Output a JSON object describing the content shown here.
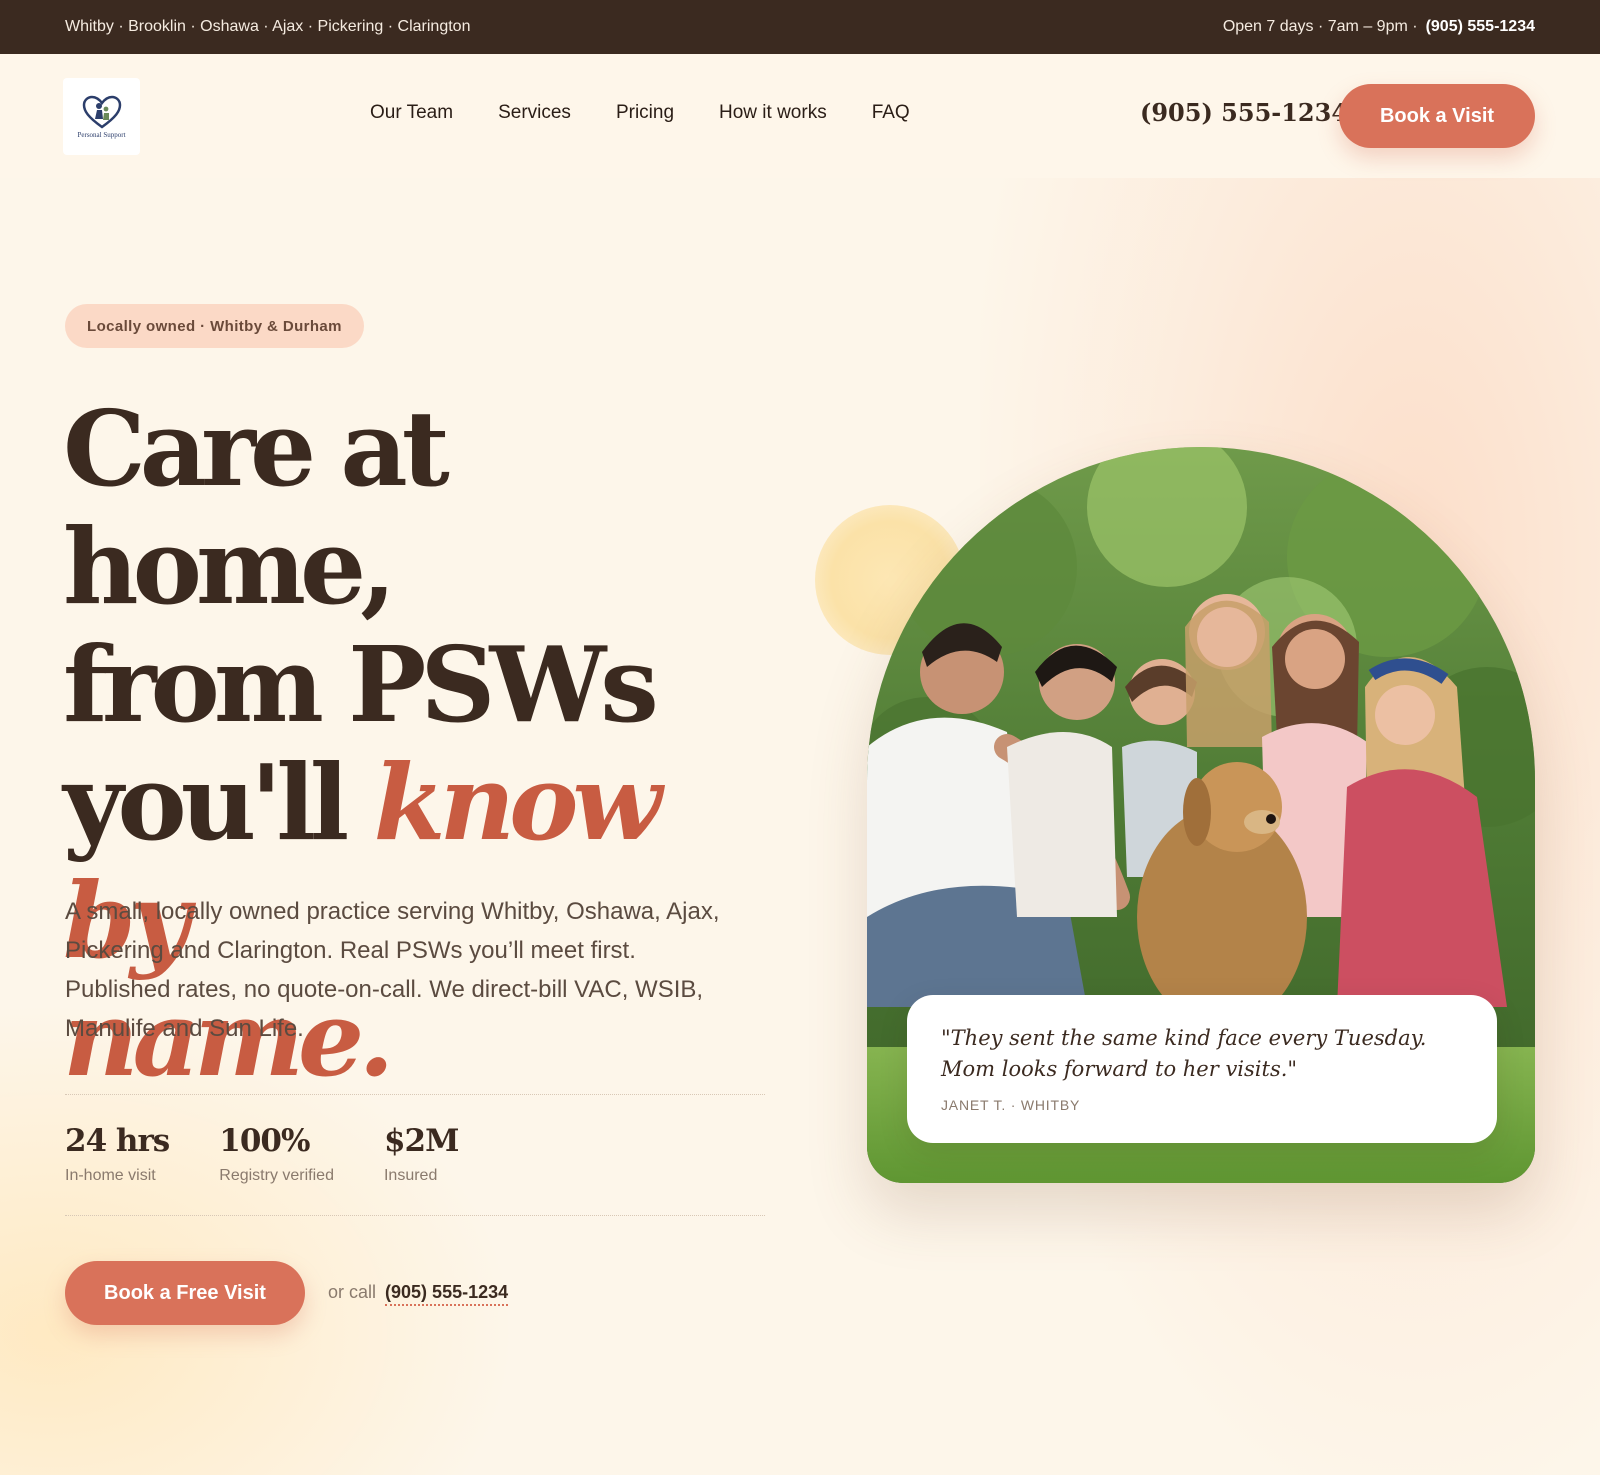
{
  "topbar": {
    "areas": "Whitby · Brooklin · Oshawa · Ajax · Pickering · Clarington",
    "hours": "Open 7 days · 7am – 9pm ·",
    "phone": "(905) 555-1234"
  },
  "header": {
    "logo_text": "Personal Support",
    "nav": [
      "Our Team",
      "Services",
      "Pricing",
      "How it works",
      "FAQ"
    ],
    "phone": "(905) 555-1234",
    "cta": "Book a Visit"
  },
  "hero": {
    "badge": "Locally owned · Whitby & Durham",
    "headline_line1": "Care at home,",
    "headline_line2": "from PSWs",
    "headline_line3_plain": "you'll ",
    "headline_line3_accent": "know by",
    "headline_line4_accent": "name.",
    "lede": "A small, locally owned practice serving Whitby, Oshawa, Ajax, Pickering and Clarington. Real PSWs you’ll meet first. Published rates, no quote-on-call. We direct-bill VAC, WSIB, Manulife and Sun Life.",
    "stats": [
      {
        "value": "24 hrs",
        "label": "In-home visit"
      },
      {
        "value": "100%",
        "label": "Registry verified"
      },
      {
        "value": "$2M",
        "label": "Insured"
      }
    ],
    "cta": "Book a Free Visit",
    "or_call": "or call",
    "cta_phone": "(905) 555-1234"
  },
  "testimonial": {
    "quote": "\"They sent the same kind face every Tuesday. Mom looks forward to her visits.\"",
    "author": "JANET T. · WHITBY"
  },
  "colors": {
    "accent": "#d9725a",
    "accent_text": "#c85c42",
    "dark": "#3b2a20",
    "background": "#fdf6ea",
    "badge": "#fbd9c6"
  },
  "icons": {
    "logo": "heart-logo-icon"
  }
}
